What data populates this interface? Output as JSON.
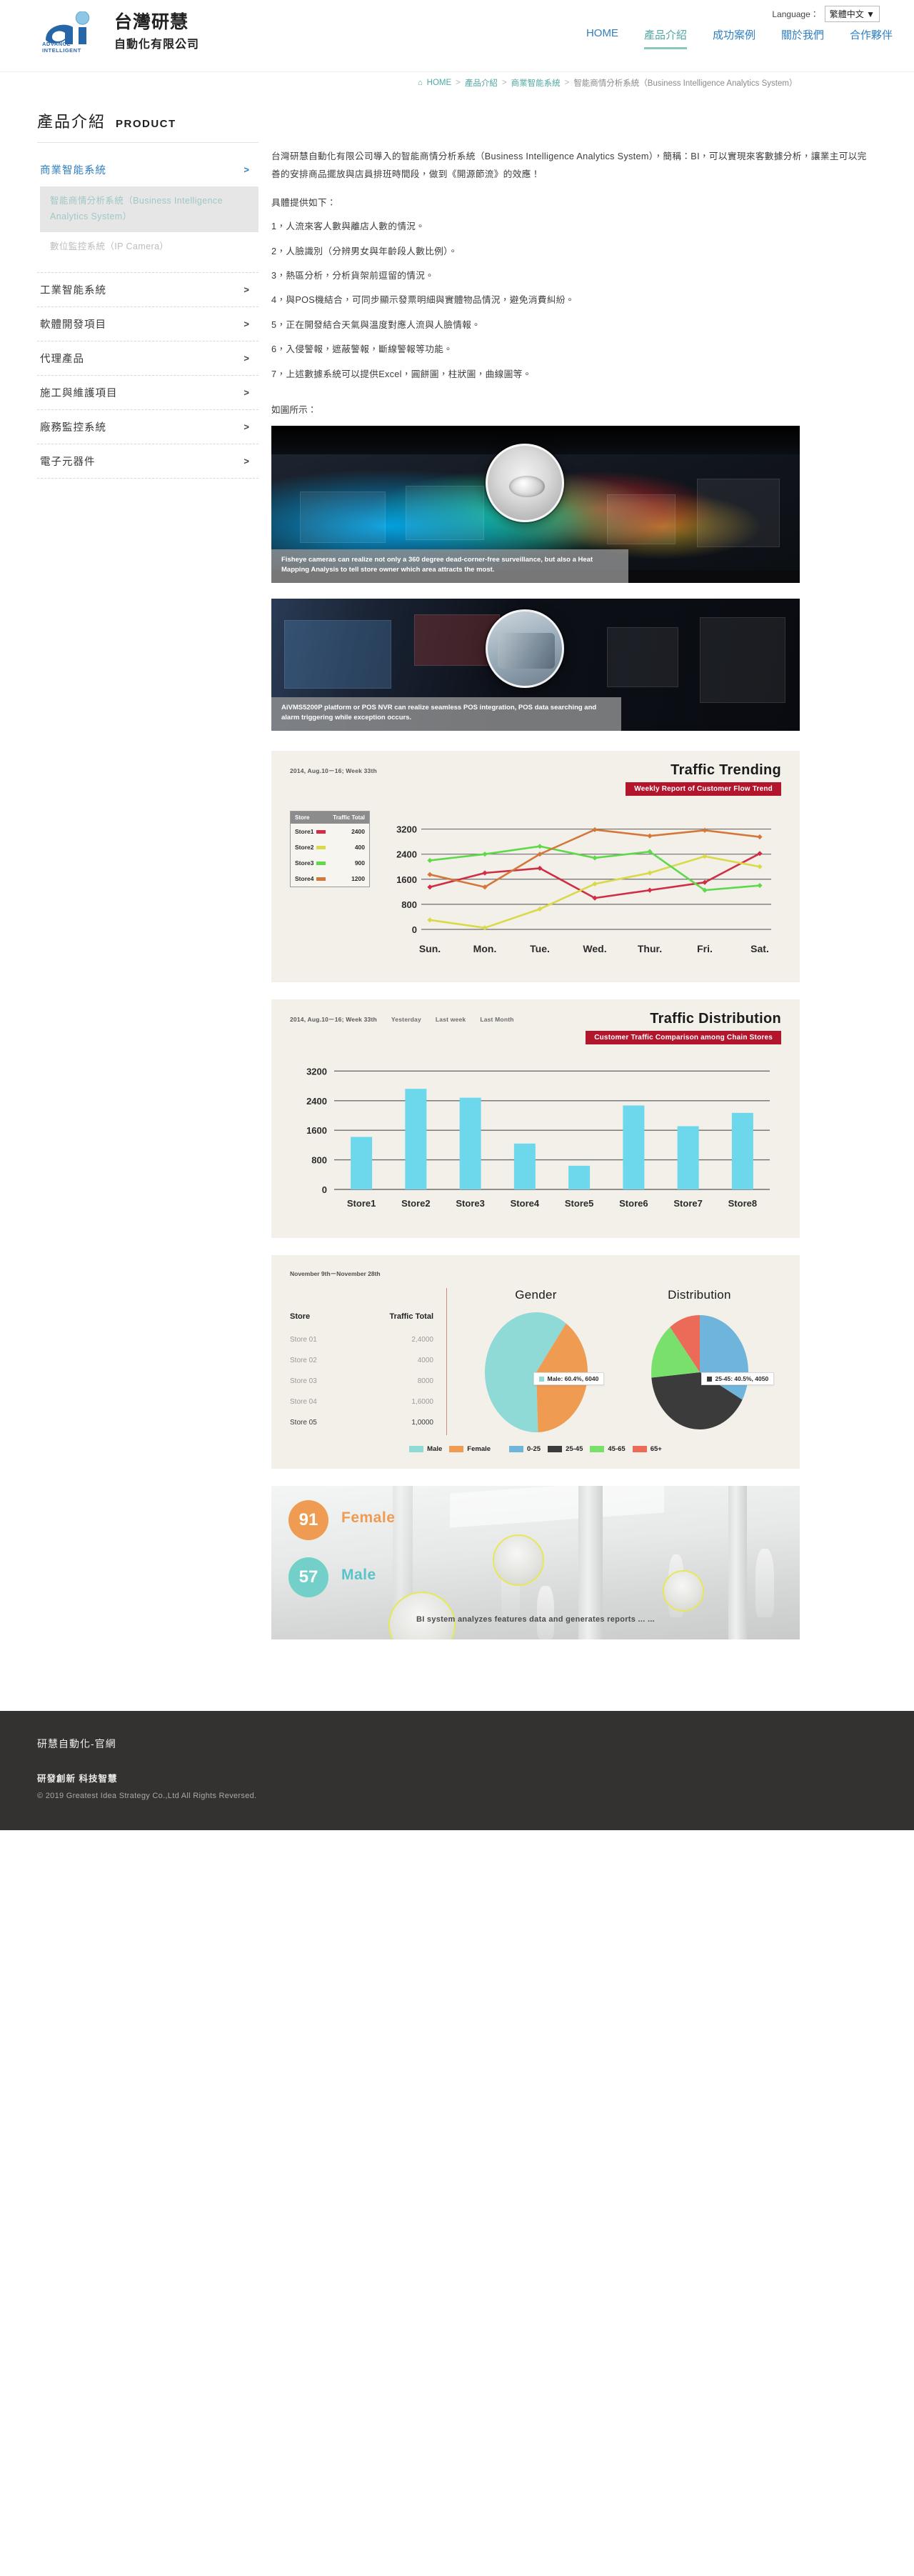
{
  "header": {
    "logo": {
      "cn_name": "台灣研慧",
      "cn_sub": "自動化有限公司",
      "tagline": "ADVANCE INTELLIGENT",
      "mark_letters": "ai"
    },
    "language_label": "Language：",
    "language_value": "繁體中文 ▼",
    "nav": [
      {
        "label": "HOME",
        "active": false
      },
      {
        "label": "產品介紹",
        "active": true
      },
      {
        "label": "成功案例",
        "active": false
      },
      {
        "label": "關於我們",
        "active": false
      },
      {
        "label": "合作夥伴",
        "active": false
      }
    ]
  },
  "breadcrumb": {
    "home_icon": "⌂",
    "items": [
      "HOME",
      "產品介紹",
      "商業智能系統"
    ],
    "separator": ">",
    "current": "智能商情分析系統（Business Intelligence Analytics System）"
  },
  "page_title": {
    "cn": "產品介紹",
    "en": "PRODUCT"
  },
  "sidebar": {
    "primary": {
      "label": "商業智能系統",
      "chevron": ">"
    },
    "sub_items": [
      {
        "label": "智能商情分析系統（Business Intelligence Analytics System）",
        "selected": true
      },
      {
        "label": "數位監控系統（IP Camera）",
        "selected": false
      }
    ],
    "categories": [
      {
        "label": "工業智能系統",
        "chevron": ">"
      },
      {
        "label": "軟體開發項目",
        "chevron": ">"
      },
      {
        "label": "代理產品",
        "chevron": ">"
      },
      {
        "label": "施工與維護項目",
        "chevron": ">"
      },
      {
        "label": "廠務監控系統",
        "chevron": ">"
      },
      {
        "label": "電子元器件",
        "chevron": ">"
      }
    ]
  },
  "content": {
    "intro": "台灣研慧自動化有限公司導入的智能商情分析系統（Business Intelligence Analytics System），簡稱：BI，可以實現來客數據分析，讓業主可以完善的安排商品擺放與店員排班時間段，做到《開源節流》的效應！",
    "lead": "具體提供如下：",
    "items": [
      "1，人流來客人數與離店人數的情況。",
      "2，人臉識別（分辨男女與年齡段人數比例）。",
      "3，熱區分析，分析貨架前逗留的情況。",
      "4，與POS機結合，可同步顯示發票明細與實體物品情況，避免消費糾紛。",
      "5，正在開發結合天氣與溫度對應人流與人臉情報。",
      "6，入侵警報，遮蔽警報，斷線警報等功能。",
      "7，上述數據系統可以提供Excel，圓餅圖，柱狀圖，曲線圖等。"
    ],
    "as_figure": "如圖所示："
  },
  "figures": {
    "fisheye_caption": "Fisheye cameras can realize not only a 360 degree dead-corner-free surveillance, but also a Heat Mapping Analysis to tell store owner which area attracts the most.",
    "pos_caption": "AiVMS5200P platform or POS NVR can realize seamless POS integration, POS data searching and alarm triggering while exception occurs.",
    "face_recognition": {
      "female_count": "91",
      "female_label": "Female",
      "male_count": "57",
      "male_label": "Male",
      "bottom_text": "BI system analyzes features data and generates reports ... ..."
    }
  },
  "chart_data": [
    {
      "type": "line",
      "title": "Traffic Trending",
      "subtitle": "Weekly Report of Customer Flow Trend",
      "meta": "2014, Aug.10－16; Week 33th",
      "xlabel": "",
      "ylabel": "",
      "categories": [
        "Sun.",
        "Mon.",
        "Tue.",
        "Wed.",
        "Thur.",
        "Fri.",
        "Sat."
      ],
      "yticks": [
        0,
        800,
        1600,
        2400,
        3200
      ],
      "ylim": [
        0,
        3600
      ],
      "grid": true,
      "legend_position": "left",
      "legend_headers": [
        "Store",
        "Traffic Total"
      ],
      "series": [
        {
          "name": "Store1",
          "total": "2400",
          "color": "#cf2e44",
          "values": [
            1350,
            1800,
            1950,
            1000,
            1250,
            1500,
            2420
          ]
        },
        {
          "name": "Store2",
          "total": "400",
          "color": "#d9d94a",
          "values": [
            300,
            50,
            650,
            1450,
            1800,
            2330,
            2000
          ]
        },
        {
          "name": "Store3",
          "total": "900",
          "color": "#5ed94a",
          "values": [
            2200,
            2400,
            2650,
            2280,
            2480,
            1250,
            1400
          ]
        },
        {
          "name": "Store4",
          "total": "1200",
          "color": "#d4773a",
          "values": [
            1750,
            1350,
            2400,
            3180,
            2980,
            3160,
            2950
          ]
        }
      ]
    },
    {
      "type": "bar",
      "title": "Traffic Distribution",
      "subtitle": "Customer Traffic Comparison among Chain Stores",
      "meta": "2014, Aug.10－16; Week 33th",
      "meta_tabs": [
        "Yesterday",
        "Last week",
        "Last Month"
      ],
      "categories": [
        "Store1",
        "Store2",
        "Store3",
        "Store4",
        "Store5",
        "Store6",
        "Store7",
        "Store8"
      ],
      "values": [
        1420,
        2720,
        2480,
        1240,
        640,
        2270,
        1710,
        2070
      ],
      "yticks": [
        0,
        800,
        1600,
        2400,
        3200
      ],
      "ylim": [
        0,
        3400
      ],
      "bar_color": "#6dd8ec",
      "grid": true
    },
    {
      "type": "pie",
      "title": "Gender",
      "meta": "November 9th－November 28th",
      "slices": [
        {
          "label": "Male",
          "value": 60.4,
          "count": 6040,
          "color": "#8fd9d6"
        },
        {
          "label": "Female",
          "value": 39.6,
          "count": 3960,
          "color": "#ef9b52"
        }
      ],
      "tooltip": "Male: 60.4%, 6040",
      "legend": [
        "Male",
        "Female"
      ]
    },
    {
      "type": "pie",
      "title": "Distribution",
      "slices": [
        {
          "label": "0-25",
          "value": 33.0,
          "color": "#6eb4db"
        },
        {
          "label": "25-45",
          "value": 40.5,
          "count": 4050,
          "color": "#3b3b3b"
        },
        {
          "label": "45-65",
          "value": 16.0,
          "color": "#7ae06c"
        },
        {
          "label": "65+",
          "value": 10.5,
          "color": "#ec6a58"
        }
      ],
      "tooltip": "25-45: 40.5%, 4050",
      "legend": [
        "0-25",
        "25-45",
        "45-65",
        "65+"
      ]
    }
  ],
  "pie_panel": {
    "meta": "November 9th－November 28th",
    "store_headers": [
      "Store",
      "Traffic Total"
    ],
    "store_rows": [
      {
        "store": "Store 01",
        "total": "2,4000"
      },
      {
        "store": "Store 02",
        "total": "4000"
      },
      {
        "store": "Store 03",
        "total": "8000"
      },
      {
        "store": "Store 04",
        "total": "1,6000"
      },
      {
        "store": "Store 05",
        "total": "1,0000"
      }
    ]
  },
  "footer": {
    "title": "研慧自動化-官網",
    "slogan": "研發創新 科技智慧",
    "copyright": "© 2019 Greatest Idea Strategy Co.,Ltd All Rights Reversed."
  }
}
